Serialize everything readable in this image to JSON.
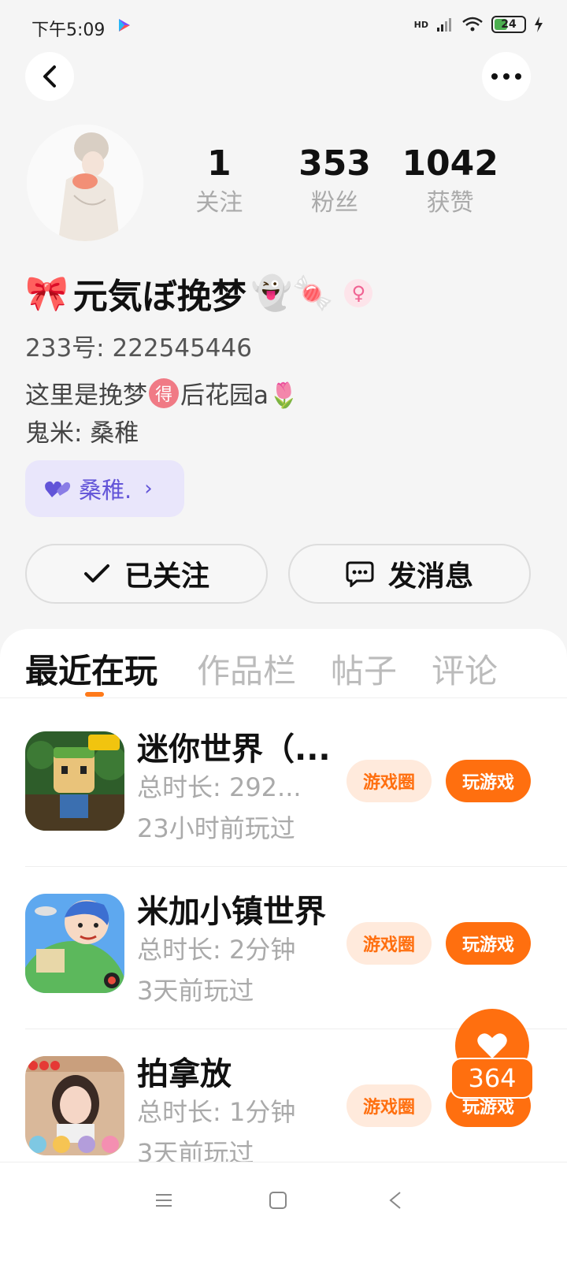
{
  "status_bar": {
    "time": "下午5:09",
    "battery": "24",
    "network": "HD"
  },
  "profile": {
    "stats": [
      {
        "value": "1",
        "label": "关注"
      },
      {
        "value": "353",
        "label": "粉丝"
      },
      {
        "value": "1042",
        "label": "获赞"
      }
    ],
    "name_prefix": "🎀",
    "name": "元気ぼ挽梦",
    "name_suffix": "👻🍬",
    "gender_symbol": "♀",
    "uid": "233号: 222545446",
    "bio_line1_before": "这里是挽梦",
    "bio_line1_badge": "得",
    "bio_line1_after": "后花园a🌷",
    "bio_line2": "鬼米: 桑稚",
    "tag_label": "桑稚.",
    "follow_label": "已关注",
    "message_label": "发消息"
  },
  "tabs": [
    "最近在玩",
    "作品栏",
    "帖子",
    "评论"
  ],
  "games": [
    {
      "title": "迷你世界（...",
      "time": "总时长: 292...",
      "last": "23小时前玩过",
      "circle_label": "游戏圈",
      "play_label": "玩游戏"
    },
    {
      "title": "米加小镇世界",
      "time": "总时长: 2分钟",
      "last": "3天前玩过",
      "circle_label": "游戏圈",
      "play_label": "玩游戏"
    },
    {
      "title": "拍拿放",
      "time": "总时长: 1分钟",
      "last": "3天前玩过",
      "circle_label": "游戏圈",
      "play_label": "玩游戏"
    }
  ],
  "like_count": "364",
  "colors": {
    "accent": "#ff6f0f",
    "accent_light": "#ffeadc",
    "tag_bg": "#e9e6fb",
    "tag_text": "#6254d8"
  }
}
